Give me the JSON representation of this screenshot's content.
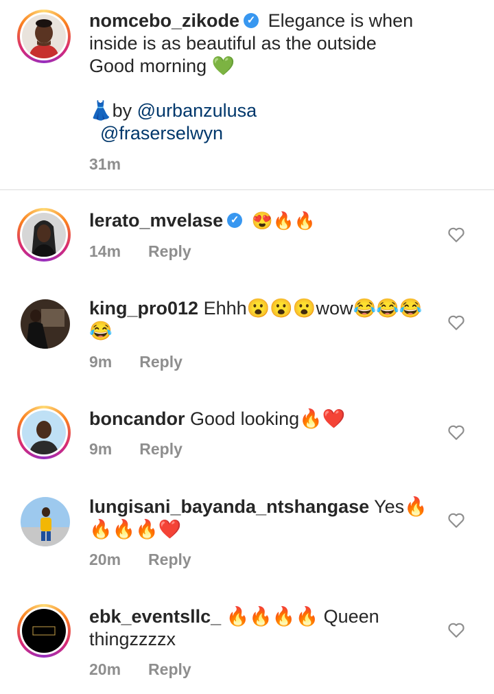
{
  "post": {
    "username": "nomcebo_zikode",
    "caption_line1": "Elegance is when",
    "caption_line2": "inside is as beautiful as the outside",
    "caption_line3": "Good morning 💚",
    "credit_prefix": "👗by ",
    "mention1": "@urbanzulusa",
    "mention2": "@fraserselwyn",
    "time": "31m"
  },
  "comments": [
    {
      "username": "lerato_mvelase",
      "verified": true,
      "text": "😍🔥🔥",
      "text2": "",
      "time": "14m",
      "reply": "Reply"
    },
    {
      "username": "king_pro012",
      "verified": false,
      "text": "Ehhh😮😮😮wow😂😂😂",
      "text2": "😂",
      "time": "9m",
      "reply": "Reply"
    },
    {
      "username": "boncandor",
      "verified": false,
      "text": "Good looking🔥❤️",
      "text2": "",
      "time": "9m",
      "reply": "Reply"
    },
    {
      "username": "lungisani_bayanda_ntshangase",
      "verified": false,
      "text": "Yes🔥",
      "text2": "🔥🔥🔥❤️",
      "time": "20m",
      "reply": "Reply"
    },
    {
      "username": "ebk_eventsllc_",
      "verified": false,
      "text": "🔥🔥🔥🔥 Queen",
      "text2": "thingzzzzx",
      "time": "20m",
      "reply": "Reply"
    }
  ],
  "icons": {
    "verified": "verified-badge-icon",
    "like": "heart-outline-icon"
  },
  "colors": {
    "mention": "#00376b",
    "meta": "#8e8e8e",
    "verified": "#3897f0"
  }
}
